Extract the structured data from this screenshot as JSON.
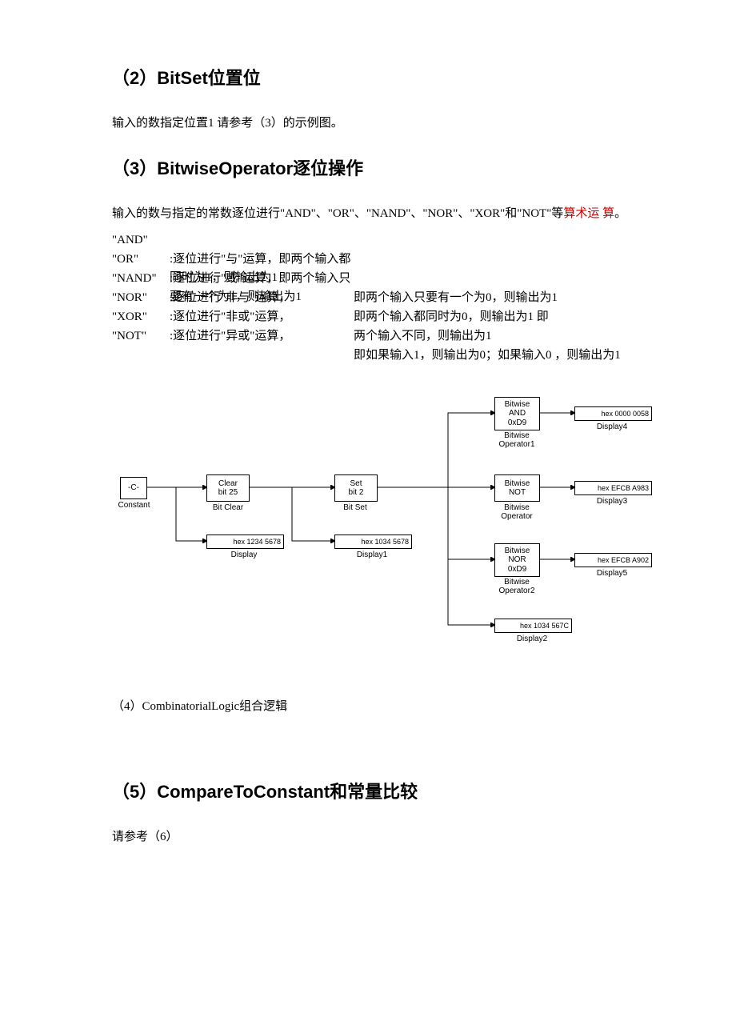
{
  "h2a": "（2）BitSet位置位",
  "p2": "输入的数指定位置1 请参考（3）的示例图。",
  "h2b": "（3）BitwiseOperator逐位操作",
  "p3a": "输入的数与指定的常数逐位进行\"AND\"、\"OR\"、\"NAND\"、\"NOR\"、\"XOR\"和\"NOT\"等",
  "p3a_red": "算术运  算",
  "p3a_end": "。",
  "ops_left": [
    "\"AND\"",
    "\"OR\"",
    "\"NAND\"",
    "\"NOR\"",
    "\"XOR\"",
    "\"NOT\""
  ],
  "ops_mid": [
    ":逐位进行\"与\"运算，",
    ":逐位进行\"或\"运算，",
    ":逐位进行\"非与\"运算，",
    ":逐位进行\"非或\"运算，",
    ":逐位进行\"异或\"运算，"
  ],
  "ops_mid0_tail": "即两个输入都同时为1，则输出为1",
  "ops_mid1_tail": "即两个输入只要有一个为1，则输出为1",
  "ops_right": [
    "即两个输入只要有一个为0，则输出为1",
    "即两个输入都同时为0，则输出为1 即",
    "两个输入不同，则输出为1",
    "即如果输入1，则输出为0；如果输入0 ，则输出为1"
  ],
  "diag": {
    "constant": "-C-",
    "constant_lbl": "Constant",
    "clear": "Clear\nbit 25",
    "clear_lbl": "Bit Clear",
    "set": "Set\nbit 2",
    "set_lbl": "Bit Set",
    "display": "hex 1234 5678",
    "display_lbl": "Display",
    "display1": "hex 1034 5678",
    "display1_lbl": "Display1",
    "display2": "hex 1034 567C",
    "display2_lbl": "Display2",
    "bw1": "Bitwise\nAND\n0xD9",
    "bw1_lbl": "Bitwise\nOperator1",
    "bw_not": "Bitwise\nNOT",
    "bw_not_lbl": "Bitwise\nOperator",
    "bw2": "Bitwise\nNOR\n0xD9",
    "bw2_lbl": "Bitwise\nOperator2",
    "display3": "hex EFCB A983",
    "display3_lbl": "Display3",
    "display4": "hex 0000 0058",
    "display4_lbl": "Display4",
    "display5": "hex EFCB A902",
    "display5_lbl": "Display5"
  },
  "section4": "（4）CombinatorialLogic组合逻辑",
  "h5": "（5）CompareToConstant和常量比较",
  "p5": "请参考（6）"
}
